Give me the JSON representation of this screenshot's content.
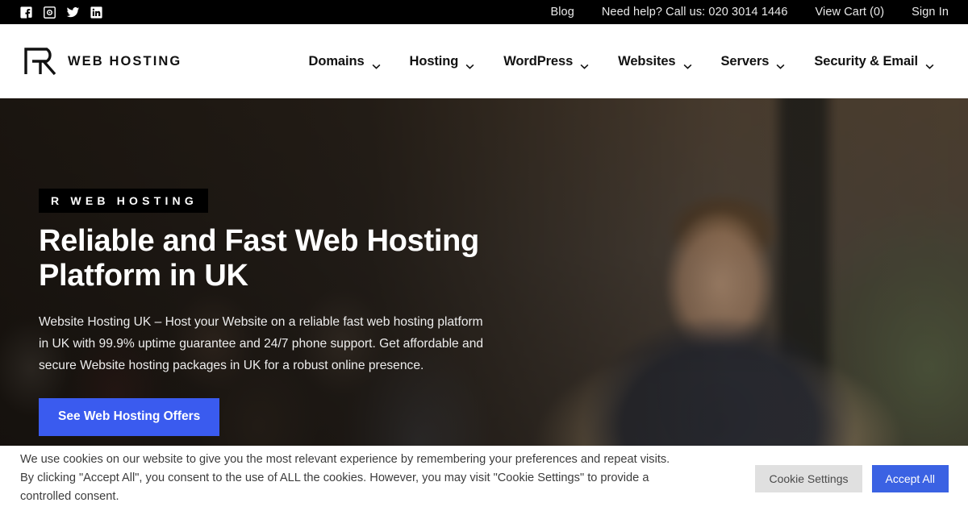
{
  "topbar": {
    "social": [
      {
        "name": "facebook-icon",
        "label": "Facebook"
      },
      {
        "name": "instagram-icon",
        "label": "Instagram"
      },
      {
        "name": "twitter-icon",
        "label": "Twitter"
      },
      {
        "name": "linkedin-icon",
        "label": "LinkedIn"
      }
    ],
    "links": [
      {
        "label": "Blog"
      },
      {
        "label": "Need help? Call us: 020 3014 1446"
      },
      {
        "label": "View Cart (0)"
      },
      {
        "label": "Sign In"
      }
    ],
    "background": "#000000"
  },
  "header": {
    "brand": {
      "mark": "r-logo-icon",
      "text": "WEB HOSTING"
    },
    "nav": [
      {
        "label": "Domains",
        "has_dropdown": true
      },
      {
        "label": "Hosting",
        "has_dropdown": true
      },
      {
        "label": "WordPress",
        "has_dropdown": true
      },
      {
        "label": "Websites",
        "has_dropdown": true
      },
      {
        "label": "Servers",
        "has_dropdown": true
      },
      {
        "label": "Security & Email",
        "has_dropdown": true
      }
    ]
  },
  "hero": {
    "eyebrow": "R WEB HOSTING",
    "title": "Reliable and Fast Web Hosting Platform in UK",
    "description": "Website Hosting UK – Host your Website on a reliable fast web hosting platform in UK with 99.9% uptime guarantee and 24/7 phone support. Get affordable and secure Website hosting packages in UK for a robust online presence.",
    "cta_label": "See Web Hosting Offers",
    "cta_color": "#3a5bef"
  },
  "cookie_banner": {
    "text": "We use cookies on our website to give you the most relevant experience by remembering your preferences and repeat visits. By clicking \"Accept All\", you consent to the use of ALL the cookies. However, you may visit \"Cookie Settings\" to provide a controlled consent.",
    "settings_label": "Cookie Settings",
    "accept_label": "Accept All",
    "settings_color": "#e0e0e0",
    "accept_color": "#3b62e3"
  }
}
